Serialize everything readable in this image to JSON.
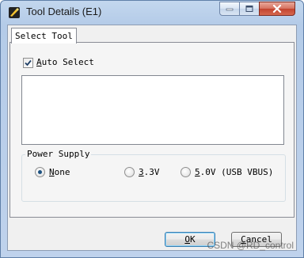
{
  "window": {
    "title": "Tool Details (E1)",
    "controls": [
      "minimize-icon",
      "maximize-icon",
      "close-icon"
    ]
  },
  "tabs": [
    {
      "label": "Select Tool",
      "selected": true
    }
  ],
  "auto_select": {
    "label_accel": "A",
    "label_rest": "uto Select",
    "checked": true
  },
  "tool_list": {
    "items": []
  },
  "power_supply": {
    "title": "Power Supply",
    "options": [
      {
        "accel": "N",
        "rest": "one",
        "selected": true
      },
      {
        "accel": "3",
        "rest": ".3V",
        "selected": false
      },
      {
        "accel": "5",
        "rest": ".0V (USB VBUS)",
        "selected": false
      }
    ]
  },
  "buttons": {
    "ok_accel": "O",
    "ok_rest": "K",
    "cancel_accel": "C",
    "cancel_rest": "ancel"
  },
  "watermark": "CSDN @RD_control",
  "colors": {
    "titlebar": "#b4cbe8",
    "client_bg": "#f0f0f0",
    "radio_dot": "#1c5180",
    "close_button": "#c2432f"
  }
}
